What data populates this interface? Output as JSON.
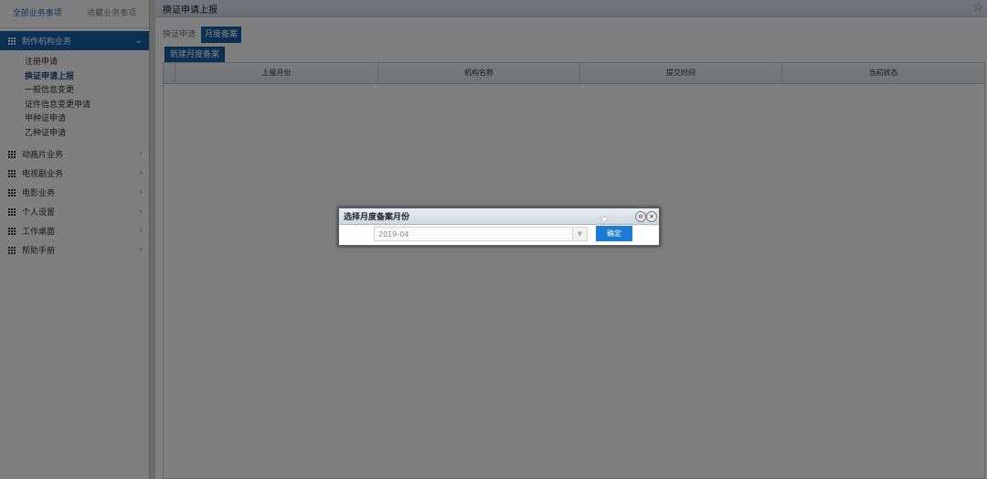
{
  "sidebar": {
    "tabs": [
      {
        "label": "全部业务事项"
      },
      {
        "label": "收藏业务事项"
      }
    ],
    "active_group": {
      "label": "制作机构业务",
      "items": [
        {
          "label": "注册申请"
        },
        {
          "label": "换证申请上报"
        },
        {
          "label": "一般信息变更"
        },
        {
          "label": "证件信息变更申请"
        },
        {
          "label": "甲种证申请"
        },
        {
          "label": "乙种证申请"
        }
      ]
    },
    "groups": [
      {
        "label": "动画片业务"
      },
      {
        "label": "电视剧业务"
      },
      {
        "label": "电影业务"
      },
      {
        "label": "个人设置"
      },
      {
        "label": "工作桌面"
      },
      {
        "label": "帮助手册"
      }
    ]
  },
  "main": {
    "title": "换证申请上报",
    "tabs": [
      {
        "label": "换证申请"
      },
      {
        "label": "月度备案"
      }
    ],
    "toolbar": {
      "new_label": "新建月度备案"
    },
    "grid": {
      "columns": [
        "上报月份",
        "机构名称",
        "提交时间",
        "当前状态"
      ]
    }
  },
  "dialog": {
    "title": "选择月度备案月份",
    "month_value": "2019-04",
    "confirm_label": "确定"
  },
  "colors": {
    "accent": "#1462a8",
    "confirm": "#1a7bd4"
  }
}
